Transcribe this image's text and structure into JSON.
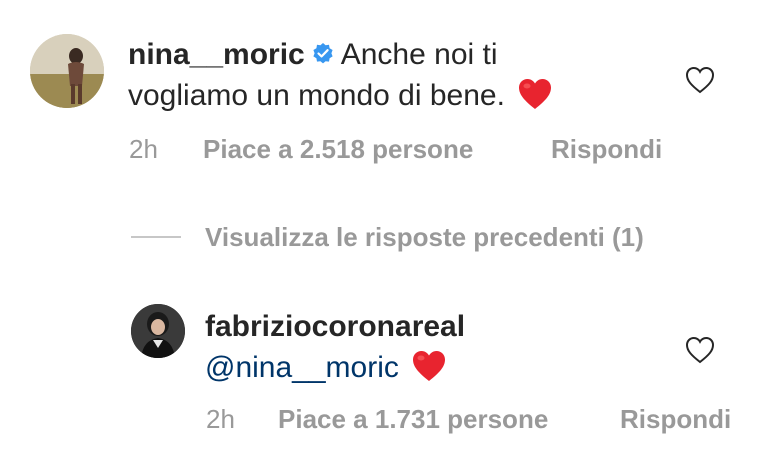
{
  "comments": [
    {
      "username": "nina__moric",
      "verified": true,
      "text_line1": "Anche noi ti",
      "text_line2": "vogliamo un mondo di bene.",
      "emoji": "heart-emoji",
      "time": "2h",
      "likes": "Piace a 2.518 persone",
      "reply": "Rispondi"
    },
    {
      "username": "fabriziocoronareal",
      "verified": false,
      "mention": "@nina__moric",
      "emoji": "heart-emoji",
      "time": "2h",
      "likes": "Piace a 1.731 persone",
      "reply": "Rispondi"
    }
  ],
  "view_replies": {
    "label": "Visualizza le risposte precedenti (1)"
  },
  "colors": {
    "text": "#262626",
    "meta": "#999999",
    "mention": "#003569",
    "verified": "#3897f0",
    "heart": "#e8242f"
  }
}
